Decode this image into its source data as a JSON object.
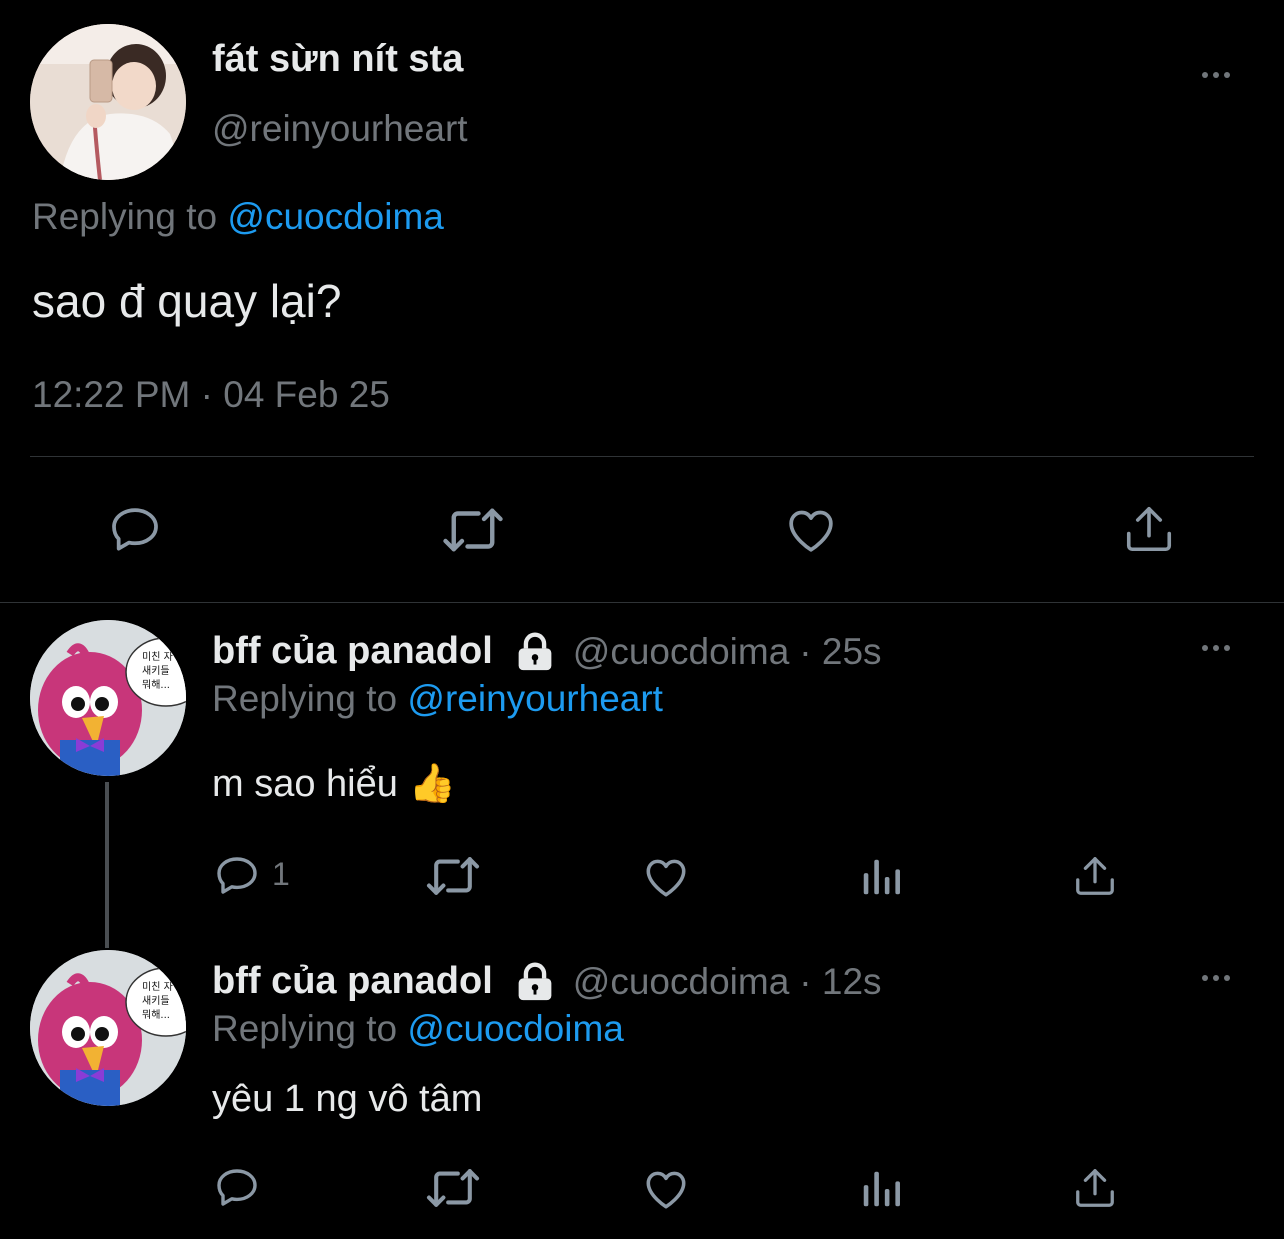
{
  "main_tweet": {
    "display_name": "fát sừn nít sta",
    "handle": "@reinyourheart",
    "replying_label": "Replying to",
    "replying_to": "@cuocdoima",
    "text": "sao đ quay lại?",
    "timestamp": "12:22 PM · 04 Feb 25",
    "avatar": "girl-selfie-avatar"
  },
  "replies": [
    {
      "display_name": "bff của panadol",
      "handle": "@cuocdoima",
      "time": "· 25s",
      "replying_label": "Replying to",
      "replying_to": "@reinyourheart",
      "text": "m sao hiểu 👍",
      "reply_count": "1",
      "avatar": "pink-bird-avatar",
      "avatar_bubble_text": "미친 자\n새키들\n뭐해..."
    },
    {
      "display_name": "bff của panadol",
      "handle": "@cuocdoima",
      "time": "· 12s",
      "replying_label": "Replying to",
      "replying_to": "@cuocdoima",
      "text": "yêu 1 ng vô tâm",
      "reply_count": "",
      "avatar": "pink-bird-avatar",
      "avatar_bubble_text": "미친 자\n새키들\n뭐해..."
    }
  ],
  "icons": [
    "reply-icon",
    "retweet-icon",
    "like-icon",
    "share-icon",
    "views-icon",
    "more-icon",
    "lock-icon"
  ],
  "colors": {
    "background": "#000000",
    "text": "#e7e9ea",
    "muted": "#71767b",
    "link": "#1d9bf0",
    "divider": "#2f3336"
  }
}
